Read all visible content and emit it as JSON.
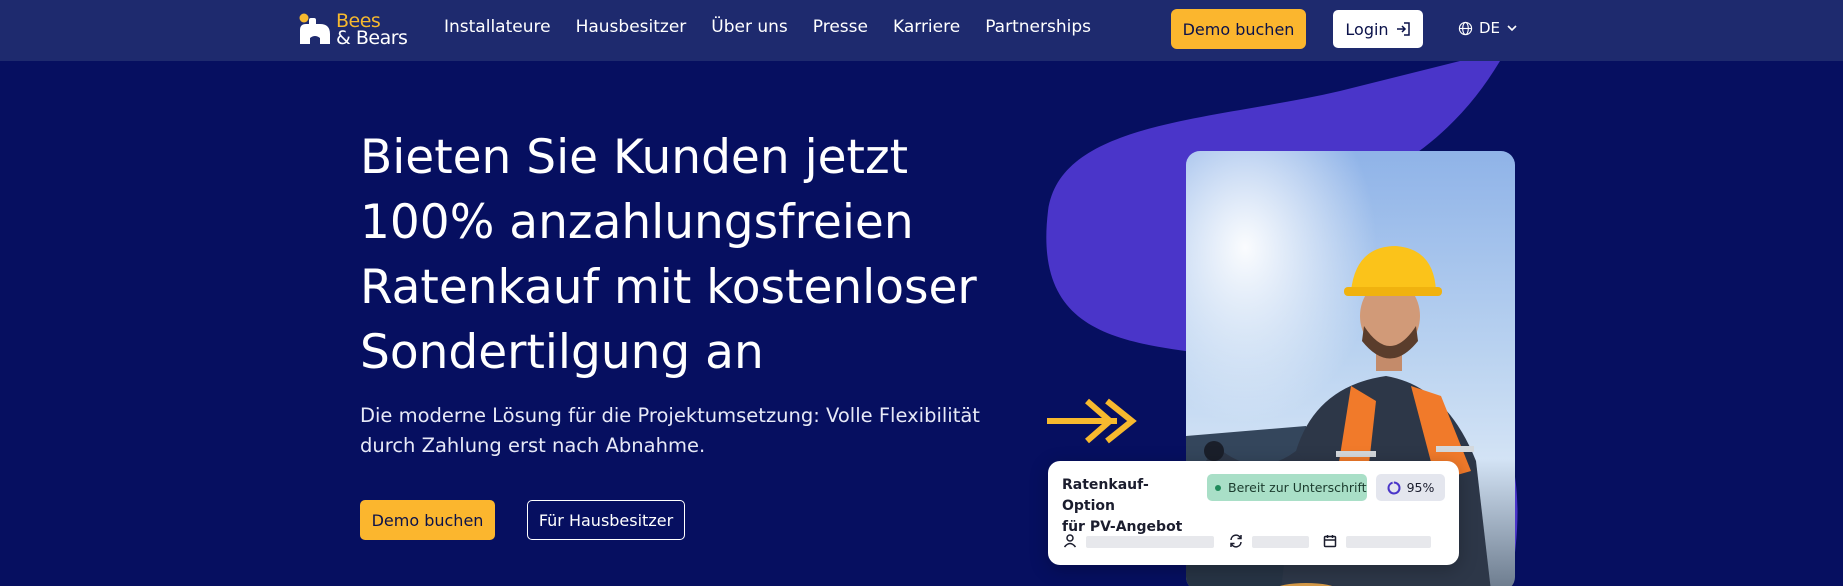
{
  "brand": {
    "name_line1": "Bees",
    "name_line2": "& Bears",
    "accent": "#fbb62e",
    "bg": "#060f60",
    "nav_bg": "#1e2a6e",
    "swoosh": "#4a35c9"
  },
  "nav": {
    "links": [
      "Installateure",
      "Hausbesitzer",
      "Über uns",
      "Presse",
      "Karriere",
      "Partnerships"
    ],
    "demo_label": "Demo buchen",
    "login_label": "Login",
    "lang_label": "DE"
  },
  "hero": {
    "title_lines": [
      "Bieten Sie Kunden jetzt",
      "100% anzahlungsfreien",
      "Ratenkauf mit kostenloser",
      "Sondertilgung an"
    ],
    "subtitle_lines": [
      "Die moderne Lösung für die Projektumsetzung: Volle Flexibilität",
      "durch Zahlung erst nach Abnahme."
    ],
    "primary_cta": "Demo buchen",
    "secondary_cta": "Für Hausbesitzer"
  },
  "card": {
    "title_line1": "Ratenkauf-Option",
    "title_line2": "für PV-Angebot",
    "status": "Bereit zur Unterschrift",
    "progress_label": "95%",
    "progress_value": 0.95,
    "icons": [
      "user-icon",
      "refresh-icon",
      "calendar-icon"
    ]
  }
}
